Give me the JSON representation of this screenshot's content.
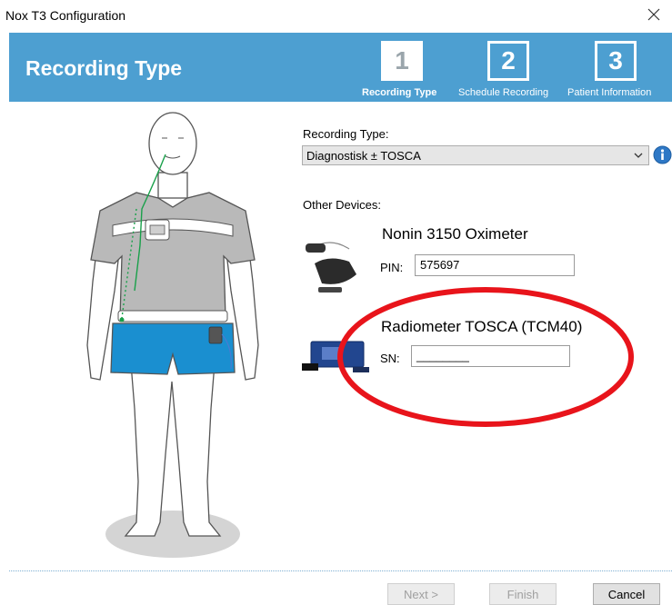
{
  "window": {
    "title": "Nox T3 Configuration"
  },
  "header": {
    "title": "Recording Type",
    "steps": [
      {
        "number": "1",
        "label": "Recording Type",
        "active": true
      },
      {
        "number": "2",
        "label": "Schedule Recording",
        "active": false
      },
      {
        "number": "3",
        "label": "Patient Information",
        "active": false
      }
    ]
  },
  "form": {
    "recording_type_label": "Recording Type:",
    "recording_type_value": "Diagnostisk ± TOSCA",
    "other_devices_label": "Other Devices:",
    "devices": [
      {
        "name": "Nonin 3150 Oximeter",
        "field_label": "PIN:",
        "field_value": "575697"
      },
      {
        "name": "Radiometer TOSCA (TCM40)",
        "field_label": "SN:",
        "field_value": "________"
      }
    ]
  },
  "buttons": {
    "next": "Next >",
    "finish": "Finish",
    "cancel": "Cancel"
  },
  "colors": {
    "header": "#4d9fd1",
    "annotation": "#e8141b",
    "shorts": "#1a8fd0"
  }
}
